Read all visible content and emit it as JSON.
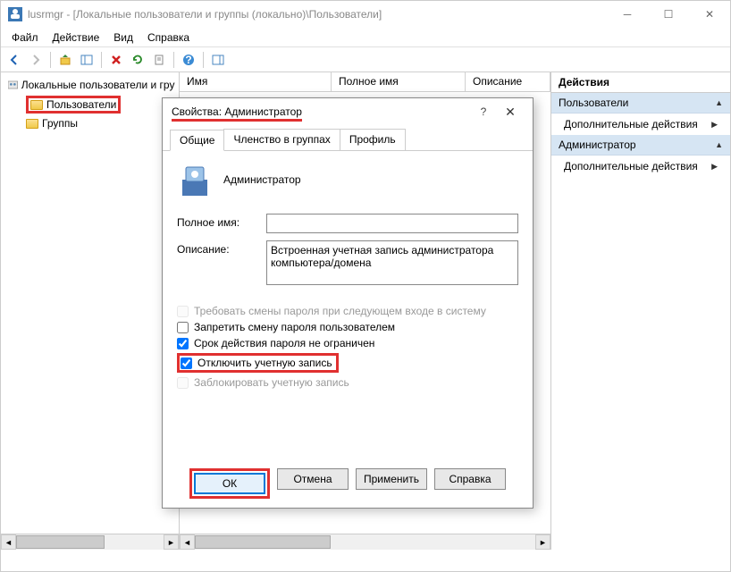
{
  "window": {
    "title": "lusrmgr - [Локальные пользователи и группы (локально)\\Пользователи]"
  },
  "menu": {
    "file": "Файл",
    "action": "Действие",
    "view": "Вид",
    "help": "Справка"
  },
  "tree": {
    "root": "Локальные пользователи и группы (локально)",
    "users": "Пользователи",
    "groups": "Группы"
  },
  "list": {
    "cols": {
      "name": "Имя",
      "fullname": "Полное имя",
      "desc": "Описание"
    }
  },
  "actions": {
    "title": "Действия",
    "group1": "Пользователи",
    "item1": "Дополнительные действия",
    "group2": "Администратор",
    "item2": "Дополнительные действия"
  },
  "dialog": {
    "title": "Свойства: Администратор",
    "tabs": {
      "general": "Общие",
      "membership": "Членство в группах",
      "profile": "Профиль"
    },
    "username": "Администратор",
    "fullname_label": "Полное имя:",
    "fullname_value": "",
    "desc_label": "Описание:",
    "desc_value": "Встроенная учетная запись администратора компьютера/домена",
    "chk": {
      "must_change": "Требовать смены пароля при следующем входе в систему",
      "cannot_change": "Запретить смену пароля пользователем",
      "never_expires": "Срок действия пароля не ограничен",
      "disabled": "Отключить учетную запись",
      "locked": "Заблокировать учетную запись"
    },
    "buttons": {
      "ok": "ОК",
      "cancel": "Отмена",
      "apply": "Применить",
      "help": "Справка"
    }
  }
}
